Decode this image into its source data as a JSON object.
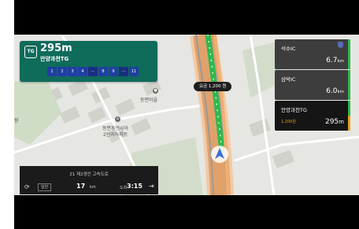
{
  "guidance": {
    "badge": "TG",
    "distance": "295m",
    "name": "안양과천TG",
    "lanes": [
      "1",
      "2",
      "3",
      "4",
      "···",
      "8",
      "9",
      "···",
      "11"
    ]
  },
  "toll": {
    "text": "요금 1,200 원"
  },
  "poi": {
    "label1": "동편마을",
    "label2": "동편휴먼시아",
    "label3": "2단지아파트",
    "edge_label": "원"
  },
  "upcoming": [
    {
      "name": "석수IC",
      "dist": "6.7",
      "unit": "km"
    },
    {
      "name": "삼막IC",
      "dist": "6.0",
      "unit": "km"
    },
    {
      "name": "안양과천TG",
      "toll": "1,200원",
      "dist": "295",
      "unit": "m"
    }
  ],
  "bottom": {
    "road": "21 제2경인 고속도로",
    "refresh_icon": "refresh-icon",
    "mode": "일반",
    "remaining": "17",
    "remaining_unit": "km",
    "arrive_label": "도착",
    "arrive_time": "3:15",
    "exit_icon": "exit-icon"
  },
  "colors": {
    "guidance_bg": "#0f6b5a",
    "lane_bg": "#1f3fa2",
    "route": "#e9a21b",
    "traffic_green": "#2fb84e"
  }
}
